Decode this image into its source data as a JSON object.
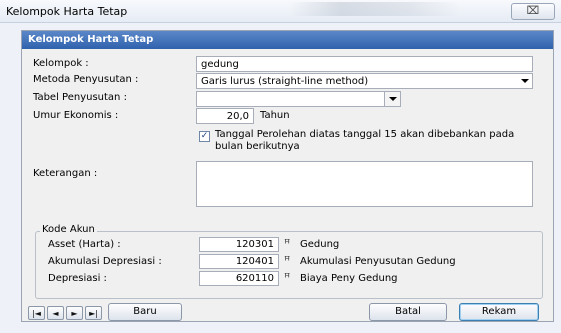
{
  "window": {
    "title": "Kelompok Harta Tetap",
    "close_glyph": "⌧"
  },
  "panel": {
    "header": "Kelompok Harta Tetap"
  },
  "form": {
    "kelompok": {
      "label": "Kelompok :",
      "value": "gedung"
    },
    "metoda": {
      "label": "Metoda Penyusutan :",
      "value": "Garis lurus (straight-line method)"
    },
    "tabel": {
      "label": "Tabel Penyusutan :",
      "value": ""
    },
    "umur": {
      "label": "Umur Ekonomis :",
      "value": "20,0",
      "unit": "Tahun"
    },
    "checkbox": {
      "checked": true,
      "glyph": "✓",
      "text": "Tanggal Perolehan diatas tanggal 15 akan dibebankan pada bulan berikutnya"
    },
    "keterangan": {
      "label": "Keterangan :",
      "value": ""
    }
  },
  "kode_akun": {
    "title": "Kode Akun",
    "rows": [
      {
        "label": "Asset (Harta) :",
        "code": "120301",
        "name": "Gedung"
      },
      {
        "label": "Akumulasi Depresiasi :",
        "code": "120401",
        "name": "Akumulasi Penyusutan Gedung"
      },
      {
        "label": "Depresiasi :",
        "code": "620110",
        "name": "Biaya Peny Gedung"
      }
    ],
    "icon": "ꟸ"
  },
  "nav": {
    "first": "|◄",
    "prev": "◄",
    "next": "►",
    "last": "►|"
  },
  "buttons": {
    "baru": "Baru",
    "batal": "Batal",
    "rekam": "Rekam"
  }
}
